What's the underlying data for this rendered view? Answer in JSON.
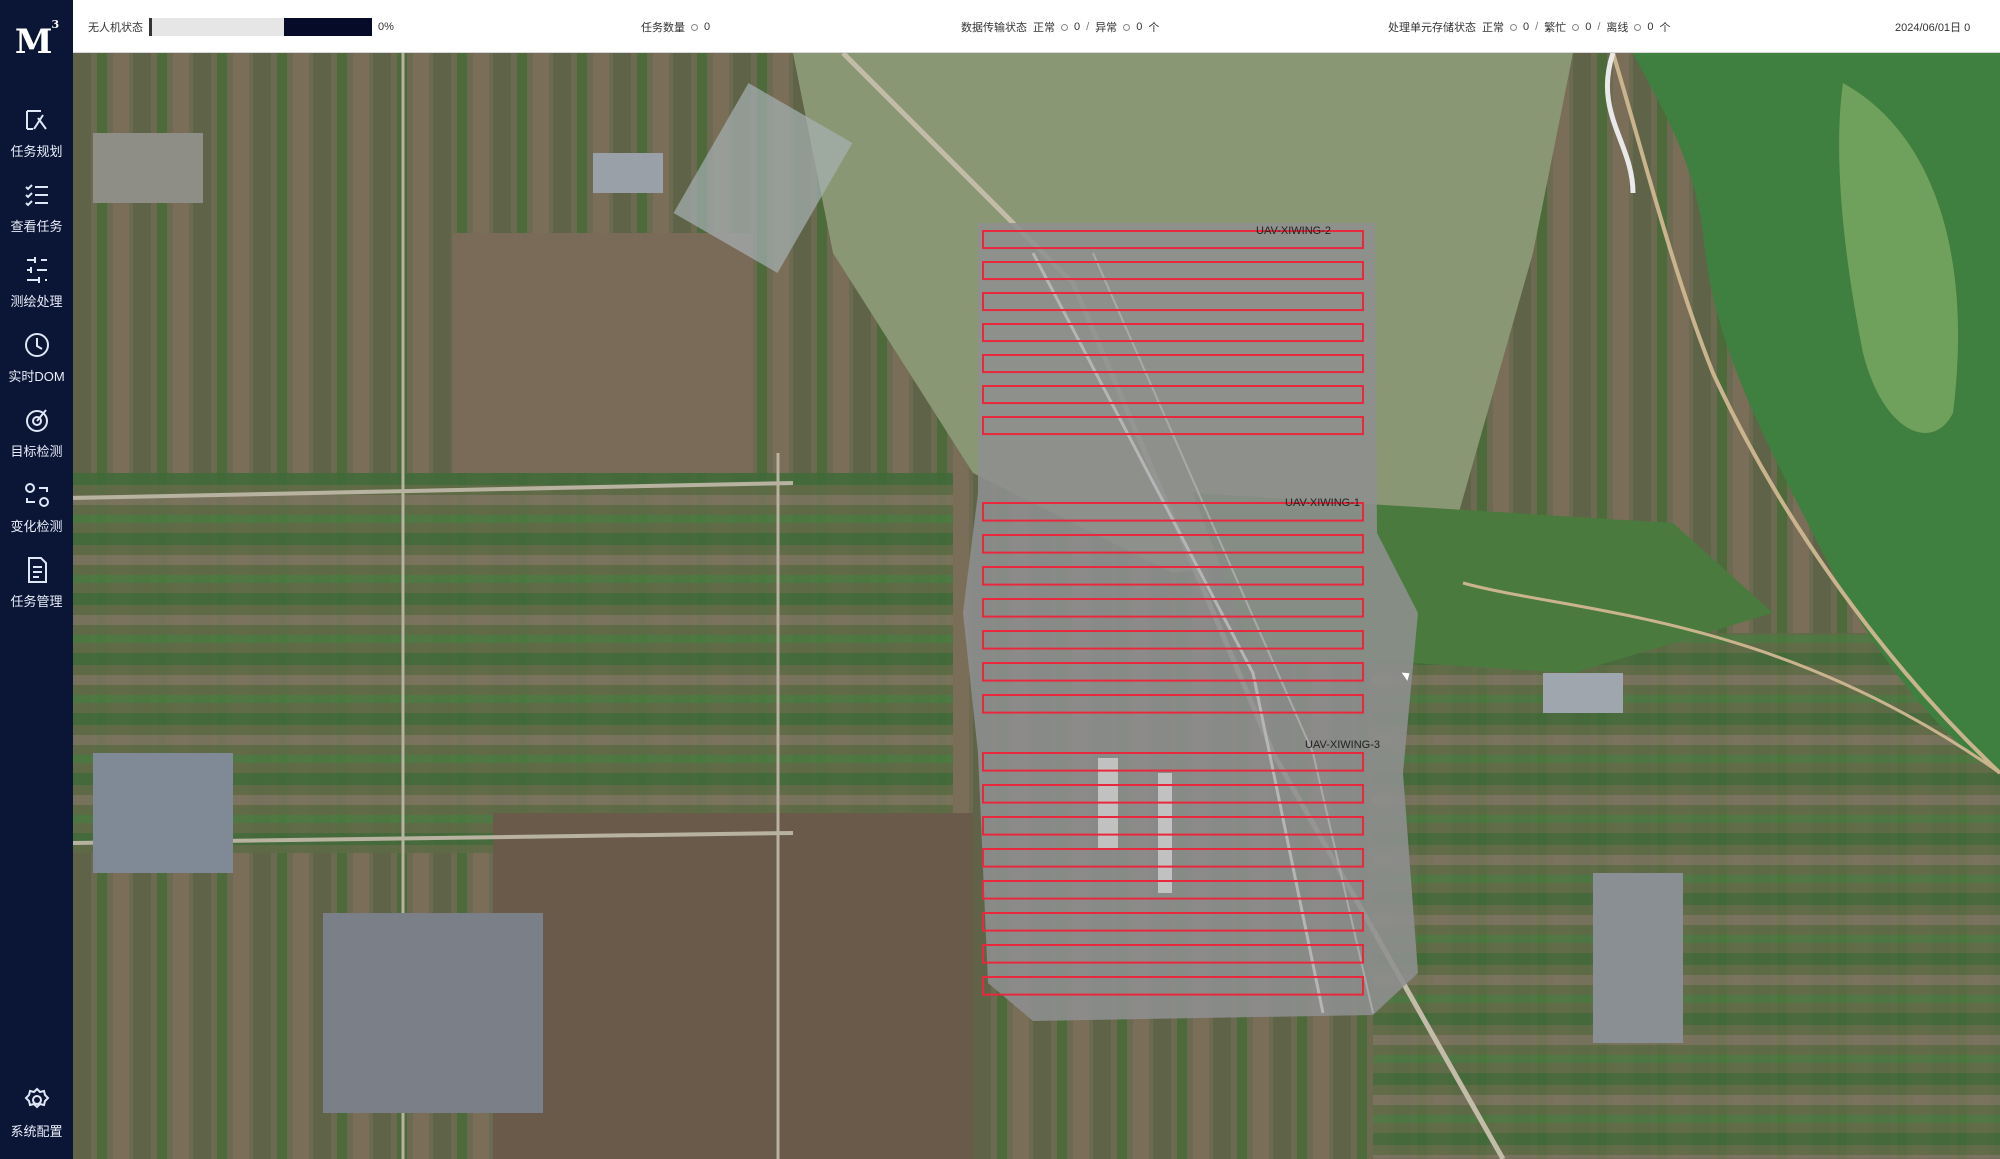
{
  "sidebar": {
    "logo": "M",
    "logo_sup": "3",
    "items": [
      {
        "label": "任务规划",
        "icon": "task-planning-icon"
      },
      {
        "label": "查看任务",
        "icon": "task-list-icon"
      },
      {
        "label": "测绘处理",
        "icon": "processing-icon"
      },
      {
        "label": "实时DOM",
        "icon": "clock-icon"
      },
      {
        "label": "目标检测",
        "icon": "target-detection-icon"
      },
      {
        "label": "变化检测",
        "icon": "change-detection-icon"
      },
      {
        "label": "任务管理",
        "icon": "document-icon"
      }
    ],
    "settings": {
      "label": "系统配置",
      "icon": "gear-icon"
    }
  },
  "header": {
    "uav_status_label": "无人机状态",
    "uav_progress": 0.4,
    "uav_percent": "0%",
    "task_count_label": "任务数量",
    "task_count_value": "0",
    "data_transfer_label": "数据传输状态",
    "data_transfer_normal": "正常",
    "data_transfer_normal_count": "0",
    "data_transfer_abnormal": "异常",
    "data_transfer_abnormal_count": "0",
    "data_transfer_unit": "个",
    "processing_label": "处理单元存储状态",
    "processing_normal": "正常",
    "processing_normal_count": "0",
    "processing_busy": "繁忙",
    "processing_busy_count": "0",
    "processing_offline": "离线",
    "processing_offline_count": "0",
    "processing_unit": "个",
    "datetime": "2024/06/01日 0"
  },
  "map": {
    "swath_labels": [
      "UAV-XIWING-2",
      "UAV-XIWING-1",
      "UAV-XIWING-3"
    ],
    "flight_line_color": "#e8283c",
    "colors": {
      "sidebar": "#0b1636",
      "water": "#3f7f3f",
      "field": "#6f7456"
    }
  }
}
